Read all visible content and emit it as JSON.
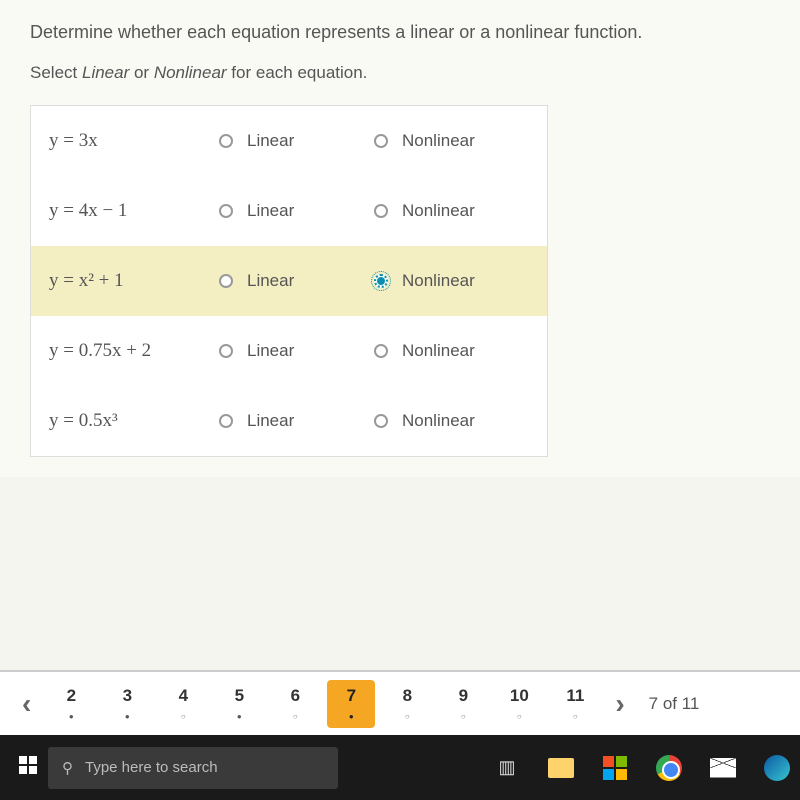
{
  "question": "Determine whether each equation represents a linear or a nonlinear function.",
  "instruction_prefix": "Select ",
  "instruction_linear": "Linear",
  "instruction_or": " or ",
  "instruction_nonlinear": "Nonlinear",
  "instruction_suffix": " for each equation.",
  "labels": {
    "linear": "Linear",
    "nonlinear": "Nonlinear"
  },
  "rows": [
    {
      "eq_html": "y = 3x",
      "selected": null
    },
    {
      "eq_html": "y = 4x − 1",
      "selected": null
    },
    {
      "eq_html": "y = x² + 1",
      "selected": "nonlinear"
    },
    {
      "eq_html": "y = 0.75x + 2",
      "selected": null
    },
    {
      "eq_html": "y = 0.5x³",
      "selected": null
    }
  ],
  "nav": {
    "pages": [
      {
        "n": "2",
        "state": "dot"
      },
      {
        "n": "3",
        "state": "dot"
      },
      {
        "n": "4",
        "state": "circle"
      },
      {
        "n": "5",
        "state": "dot"
      },
      {
        "n": "6",
        "state": "circle"
      },
      {
        "n": "7",
        "state": "dot",
        "current": true
      },
      {
        "n": "8",
        "state": "circle"
      },
      {
        "n": "9",
        "state": "circle"
      },
      {
        "n": "10",
        "state": "circle"
      },
      {
        "n": "11",
        "state": "circle"
      }
    ],
    "counter": "7 of 11"
  },
  "taskbar": {
    "search_placeholder": "Type here to search"
  }
}
